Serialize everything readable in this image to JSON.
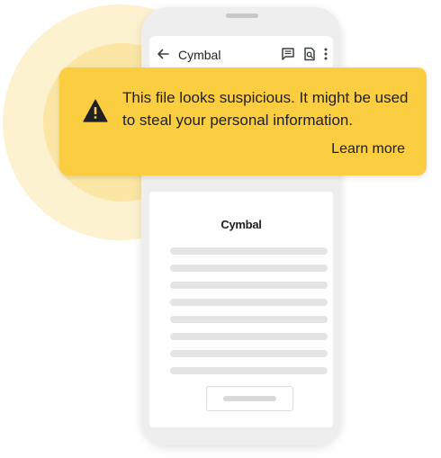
{
  "app": {
    "title": "Cymbal"
  },
  "toolbar": {
    "icons": [
      "back-arrow-icon",
      "comment-icon",
      "find-in-page-icon",
      "more-vert-icon"
    ]
  },
  "warning": {
    "message": "This file looks suspicious. It might be used to steal your personal information.",
    "link": "Learn more",
    "icon": "warning-icon",
    "color": "#fbcd41"
  },
  "document": {
    "brand": "Cymbal"
  },
  "colors": {
    "halo_outer": "#fdf2cf",
    "halo_inner": "#fbe6a6",
    "phone_frame": "#eeeeee",
    "placeholder_line": "#e4e4e4"
  }
}
